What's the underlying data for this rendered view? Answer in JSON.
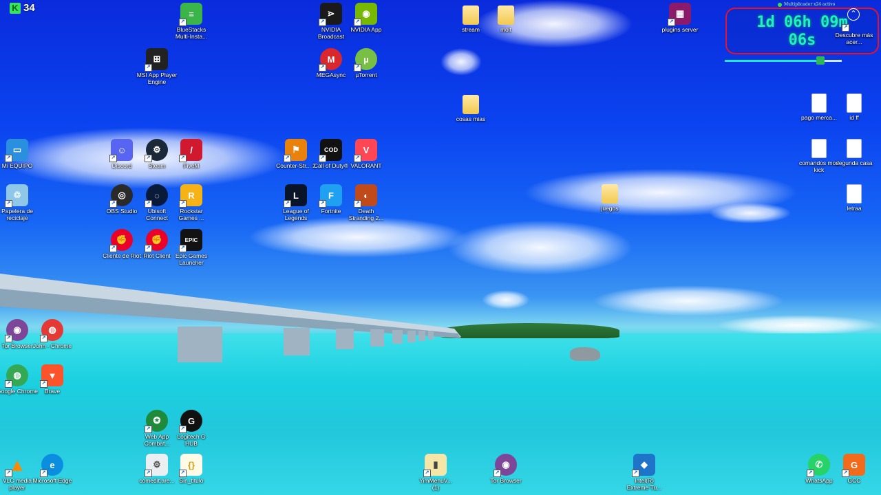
{
  "badge": {
    "letter": "K",
    "count": "34"
  },
  "timer": {
    "status": "Multiplicador x24 activo",
    "line1": "1d 06h 09m",
    "line2": "06s",
    "progress": 0.82,
    "status_color": "#3ce04c"
  },
  "icons": [
    {
      "id": "bluestacks",
      "label": "BlueStacks Multi-Insta...",
      "glyph": "≡",
      "bg": "#3bb54a",
      "icon": "bluestacks-icon"
    },
    {
      "id": "msi",
      "label": "MSI App Player Engine",
      "glyph": "⊞",
      "bg": "#222",
      "icon": "msi-app-player-icon"
    },
    {
      "id": "nvbroadcast",
      "label": "NVIDIA Broadcast",
      "glyph": "⋗",
      "bg": "#1a1a1a",
      "icon": "nvidia-broadcast-icon"
    },
    {
      "id": "nvapp",
      "label": "NVIDIA App",
      "glyph": "◉",
      "bg": "#76b900",
      "icon": "nvidia-app-icon"
    },
    {
      "id": "mega",
      "label": "MEGAsync",
      "glyph": "M",
      "bg": "#d9272e",
      "icon": "megasync-icon"
    },
    {
      "id": "utorrent",
      "label": "µTorrent",
      "glyph": "µ",
      "bg": "#78c044",
      "icon": "utorrent-icon"
    },
    {
      "id": "stream",
      "label": "stream",
      "glyph": "",
      "bg": "",
      "icon": "folder-icon"
    },
    {
      "id": "molt",
      "label": "molt",
      "glyph": "",
      "bg": "",
      "icon": "folder-icon"
    },
    {
      "id": "cosas",
      "label": "cosas mias",
      "glyph": "",
      "bg": "",
      "icon": "folder-icon"
    },
    {
      "id": "plugins",
      "label": "plugins server",
      "glyph": "▦",
      "bg": "#8b1b6a",
      "icon": "winrar-archive-icon"
    },
    {
      "id": "descubre",
      "label": "Descubre más acer...",
      "glyph": "",
      "bg": "",
      "icon": "spotlight-icon"
    },
    {
      "id": "pagomerca",
      "label": "pago merca...",
      "glyph": "",
      "bg": "",
      "icon": "text-file-icon"
    },
    {
      "id": "idff",
      "label": "id ff",
      "glyph": "",
      "bg": "",
      "icon": "text-file-icon"
    },
    {
      "id": "comandos",
      "label": "comandos mod kick",
      "glyph": "",
      "bg": "",
      "icon": "text-file-icon"
    },
    {
      "id": "segunda",
      "label": "segunda casa",
      "glyph": "",
      "bg": "",
      "icon": "text-file-icon"
    },
    {
      "id": "juegos",
      "label": "juegos",
      "glyph": "",
      "bg": "",
      "icon": "folder-icon"
    },
    {
      "id": "letraa",
      "label": "letraa",
      "glyph": "",
      "bg": "",
      "icon": "text-file-icon"
    },
    {
      "id": "miequipo",
      "label": "Mi EQUIPO",
      "glyph": "▭",
      "bg": "#2b8fe0",
      "icon": "computer-icon"
    },
    {
      "id": "papelera",
      "label": "Papelera de reciclaje",
      "glyph": "♲",
      "bg": "#8fc7e8",
      "icon": "recycle-bin-icon"
    },
    {
      "id": "discord",
      "label": "Discord",
      "glyph": "☺",
      "bg": "#5865f2",
      "icon": "discord-icon"
    },
    {
      "id": "steam",
      "label": "Steam",
      "glyph": "⚙",
      "bg": "#1b2838",
      "icon": "steam-icon"
    },
    {
      "id": "fivem",
      "label": "FiveM",
      "glyph": "/",
      "bg": "#d0192f",
      "icon": "fivem-icon"
    },
    {
      "id": "cs2",
      "label": "Counter-Str... 2",
      "glyph": "⚑",
      "bg": "#e8820c",
      "icon": "counter-strike-icon"
    },
    {
      "id": "cod",
      "label": "Call of Duty®",
      "glyph": "COD",
      "bg": "#111",
      "icon": "call-of-duty-icon"
    },
    {
      "id": "valorant",
      "label": "VALORANT",
      "glyph": "V",
      "bg": "#ff4655",
      "icon": "valorant-icon"
    },
    {
      "id": "obs",
      "label": "OBS Studio",
      "glyph": "◎",
      "bg": "#2a2a2a",
      "icon": "obs-icon"
    },
    {
      "id": "ubisoft",
      "label": "Ubisoft Connect",
      "glyph": "◌",
      "bg": "#0a1a3a",
      "icon": "ubisoft-icon"
    },
    {
      "id": "rockstar",
      "label": "Rockstar Games ...",
      "glyph": "R",
      "bg": "#f7b316",
      "icon": "rockstar-icon"
    },
    {
      "id": "lol",
      "label": "League of Legends",
      "glyph": "L",
      "bg": "#0a1428",
      "icon": "league-of-legends-icon"
    },
    {
      "id": "fortnite",
      "label": "Fortnite",
      "glyph": "F",
      "bg": "#1fa0f0",
      "icon": "fortnite-icon"
    },
    {
      "id": "deathstranding",
      "label": "Death Stranding 2...",
      "glyph": "◐",
      "bg": "#c04a1a",
      "icon": "death-stranding-icon"
    },
    {
      "id": "clienteriot",
      "label": "Cliente de Riot",
      "glyph": "✊",
      "bg": "#eb0029",
      "icon": "riot-client-icon"
    },
    {
      "id": "riotclient",
      "label": "Riot Client",
      "glyph": "✊",
      "bg": "#eb0029",
      "icon": "riot-client-icon"
    },
    {
      "id": "epic",
      "label": "Epic Games Launcher",
      "glyph": "EPIC",
      "bg": "#121212",
      "icon": "epic-games-icon"
    },
    {
      "id": "torbrowser1",
      "label": "Tor Browser",
      "glyph": "◉",
      "bg": "#7d4698",
      "icon": "tor-browser-icon"
    },
    {
      "id": "johnchrome",
      "label": "John - Chrome",
      "glyph": "◍",
      "bg": "#e53935",
      "icon": "chrome-profile-icon"
    },
    {
      "id": "chrome",
      "label": "Google Chrome",
      "glyph": "◍",
      "bg": "#34a853",
      "icon": "chrome-icon"
    },
    {
      "id": "brave",
      "label": "Brave",
      "glyph": "▼",
      "bg": "#fb542b",
      "icon": "brave-icon"
    },
    {
      "id": "webapp",
      "label": "Web App Combat...",
      "glyph": "✪",
      "bg": "#1e8a3b",
      "icon": "web-app-icon"
    },
    {
      "id": "logitech",
      "label": "Logitech G HUB",
      "glyph": "G",
      "bg": "#111",
      "icon": "logitech-ghub-icon"
    },
    {
      "id": "vlc",
      "label": "VLC media player",
      "glyph": "▲",
      "bg": "#ff8800",
      "icon": "vlc-icon"
    },
    {
      "id": "edge",
      "label": "Microsoft Edge",
      "glyph": "e",
      "bg": "#0c8ee0",
      "icon": "edge-icon"
    },
    {
      "id": "cornedit",
      "label": "comedit.are...",
      "glyph": "⚙",
      "bg": "#eceff1",
      "icon": "settings-file-icon"
    },
    {
      "id": "sintitulo",
      "label": "Sin_titulo",
      "glyph": "{}",
      "bg": "#fffbe6",
      "icon": "json-file-icon"
    },
    {
      "id": "ymm",
      "label": "YimMenuV... (1)",
      "glyph": "▮",
      "bg": "#f5e6a8",
      "icon": "archive-icon"
    },
    {
      "id": "torbrowser2",
      "label": "Tor Browser",
      "glyph": "◉",
      "bg": "#7d4698",
      "icon": "tor-browser-icon"
    },
    {
      "id": "intel",
      "label": "Intel(R) Extreme Tu...",
      "glyph": "◆",
      "bg": "#1d74c8",
      "icon": "intel-xtu-icon"
    },
    {
      "id": "whatsapp",
      "label": "WhatsApp",
      "glyph": "✆",
      "bg": "#25d366",
      "icon": "whatsapp-icon"
    },
    {
      "id": "gcc",
      "label": "GCC",
      "glyph": "G",
      "bg": "#f26b1d",
      "icon": "gcc-icon"
    }
  ]
}
